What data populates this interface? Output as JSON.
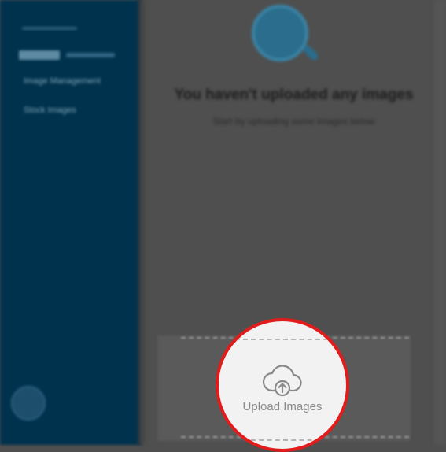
{
  "sidebar": {
    "nav": [
      {
        "label": "Image Management"
      },
      {
        "label": "Stock Images"
      }
    ]
  },
  "empty_state": {
    "title": "You haven't uploaded any images",
    "subtitle": "Start by uploading some images below"
  },
  "upload": {
    "label": "Upload Images",
    "icon": "cloud-upload-icon"
  },
  "colors": {
    "sidebar": "#00324d",
    "overlay": "#4f4f4f",
    "highlight_ring": "#e21b1b",
    "accent": "#2a6d8c"
  }
}
